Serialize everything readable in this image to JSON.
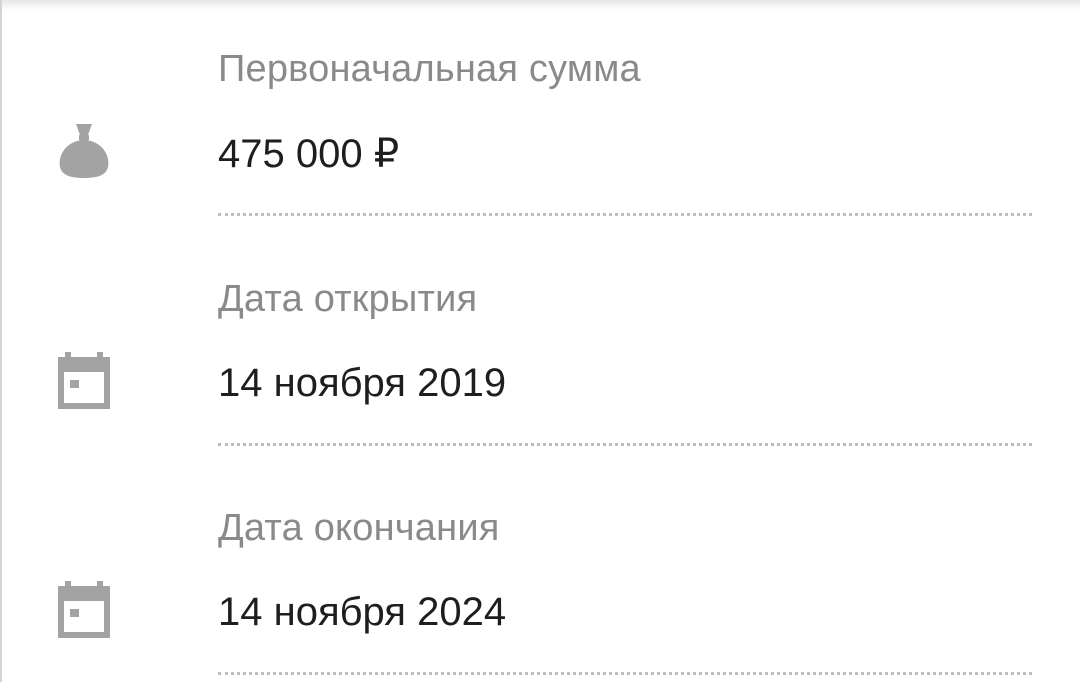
{
  "fields": [
    {
      "icon": "money-bag-icon",
      "label": "Первоначальная сумма",
      "value": "475 000 ₽"
    },
    {
      "icon": "calendar-icon",
      "label": "Дата открытия",
      "value": "14 ноября 2019"
    },
    {
      "icon": "calendar-icon",
      "label": "Дата окончания",
      "value": "14 ноября 2024"
    }
  ],
  "colors": {
    "label": "#8a8a8a",
    "value": "#1e1e1e",
    "icon": "#a3a3a3",
    "divider": "#bdbdbd"
  }
}
